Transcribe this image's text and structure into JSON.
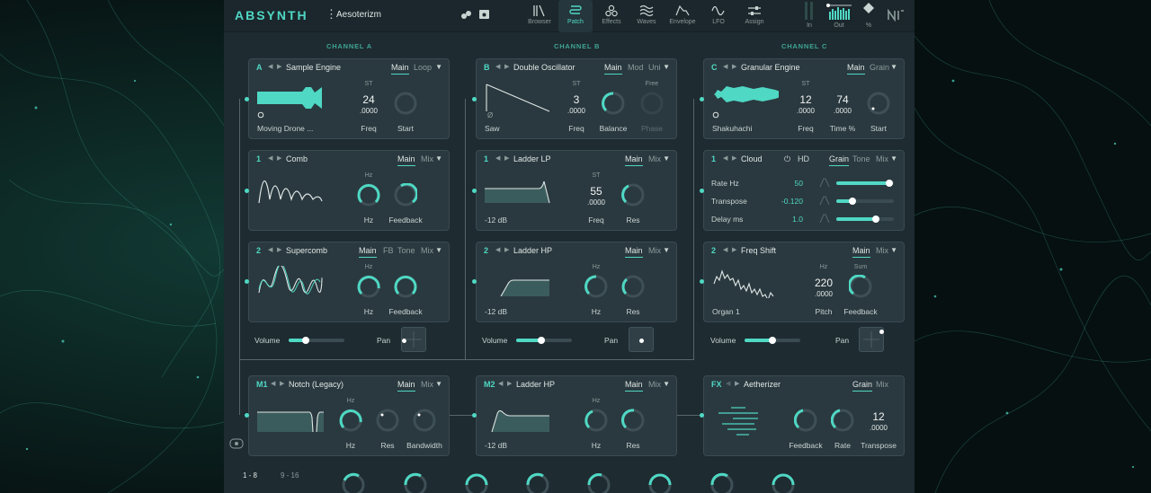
{
  "app": {
    "logo": "ABSYNTH",
    "preset_name": "Aesoterizm",
    "brand": "NI",
    "accent_color": "#4fd8c4"
  },
  "nav": [
    {
      "label": "Browser",
      "icon": "browser-icon"
    },
    {
      "label": "Patch",
      "icon": "patch-icon",
      "active": true
    },
    {
      "label": "Effects",
      "icon": "effects-icon"
    },
    {
      "label": "Waves",
      "icon": "waves-icon"
    },
    {
      "label": "Envelope",
      "icon": "envelope-icon"
    },
    {
      "label": "LFO",
      "icon": "lfo-icon"
    },
    {
      "label": "Assign",
      "icon": "assign-icon"
    }
  ],
  "meters": {
    "in_label": "In",
    "out_label": "Out",
    "cpu_label": "%"
  },
  "channels": {
    "a": "CHANNEL A",
    "b": "CHANNEL B",
    "c": "CHANNEL C"
  },
  "a1": {
    "id": "A",
    "name": "Sample Engine",
    "tabs": [
      "Main",
      "Loop"
    ],
    "sample": "Moving Drone ...",
    "freq_unit": "ST",
    "freq_value": "24",
    "freq_sub": ".0000",
    "freq_label": "Freq",
    "start_label": "Start"
  },
  "a2": {
    "id": "1",
    "name": "Comb",
    "tabs": [
      "Main",
      "Mix"
    ],
    "hz_unit": "Hz",
    "hz_label": "Hz",
    "feedback_label": "Feedback"
  },
  "a3": {
    "id": "2",
    "name": "Supercomb",
    "tabs": [
      "Main",
      "FB",
      "Tone",
      "Mix"
    ],
    "hz_unit": "Hz",
    "hz_label": "Hz",
    "feedback_label": "Feedback"
  },
  "a_mix": {
    "volume_label": "Volume",
    "volume": 0.3,
    "pan_label": "Pan"
  },
  "b1": {
    "id": "B",
    "name": "Double Oscillator",
    "tabs": [
      "Main",
      "Mod",
      "Uni"
    ],
    "wave": "Saw",
    "freq_unit": "ST",
    "freq_value": "3",
    "freq_sub": ".0000",
    "freq_label": "Freq",
    "balance_label": "Balance",
    "free_label": "Free",
    "phase_label": "Phase",
    "phase_symbol": "Ø"
  },
  "b2": {
    "id": "1",
    "name": "Ladder LP",
    "tabs": [
      "Main",
      "Mix"
    ],
    "slope": "-12 dB",
    "freq_unit": "ST",
    "freq_value": "55",
    "freq_sub": ".0000",
    "freq_label": "Freq",
    "res_label": "Res"
  },
  "b3": {
    "id": "2",
    "name": "Ladder HP",
    "tabs": [
      "Main",
      "Mix"
    ],
    "slope": "-12 dB",
    "hz_unit": "Hz",
    "hz_label": "Hz",
    "res_label": "Res"
  },
  "b_mix": {
    "volume_label": "Volume",
    "volume": 0.45,
    "pan_label": "Pan"
  },
  "c1": {
    "id": "C",
    "name": "Granular Engine",
    "tabs": [
      "Main",
      "Grain"
    ],
    "sample": "Shakuhachi",
    "freq_unit": "ST",
    "freq_value": "12",
    "freq_sub": ".0000",
    "freq_label": "Freq",
    "time_value": "74",
    "time_sub": ".0000",
    "time_label": "Time %",
    "start_label": "Start"
  },
  "c2": {
    "id": "1",
    "name": "Cloud",
    "hd_label": "HD",
    "tabs": [
      "Grain",
      "Tone",
      "Mix"
    ],
    "rows": [
      {
        "label": "Rate Hz",
        "value": "50",
        "level": 0.92
      },
      {
        "label": "Transpose",
        "value": "-0.120",
        "level": 0.28
      },
      {
        "label": "Delay ms",
        "value": "1.0",
        "level": 0.68
      }
    ]
  },
  "c3": {
    "id": "2",
    "name": "Freq Shift",
    "tabs": [
      "Main",
      "Mix"
    ],
    "source": "Organ 1",
    "pitch_unit": "Hz",
    "pitch_value": "220",
    "pitch_sub": ".0000",
    "pitch_label": "Pitch",
    "sum_label": "Sum",
    "feedback_label": "Feedback"
  },
  "c_mix": {
    "volume_label": "Volume",
    "volume": 0.5,
    "pan_label": "Pan"
  },
  "m1": {
    "id": "M1",
    "name": "Notch (Legacy)",
    "tabs": [
      "Main",
      "Mix"
    ],
    "hz_unit": "Hz",
    "hz_label": "Hz",
    "res_label": "Res",
    "bandwidth_label": "Bandwidth"
  },
  "m2": {
    "id": "M2",
    "name": "Ladder HP",
    "tabs": [
      "Main",
      "Mix"
    ],
    "slope": "-12 dB",
    "hz_unit": "Hz",
    "hz_label": "Hz",
    "res_label": "Res"
  },
  "fx": {
    "id": "FX",
    "name": "Aetherizer",
    "tabs": [
      "Grain",
      "Mix"
    ],
    "feedback_label": "Feedback",
    "rate_label": "Rate",
    "transpose_value": "12",
    "transpose_sub": ".0000",
    "transpose_label": "Transpose"
  },
  "macros": {
    "page1": "1 - 8",
    "page2": "9 - 16"
  }
}
